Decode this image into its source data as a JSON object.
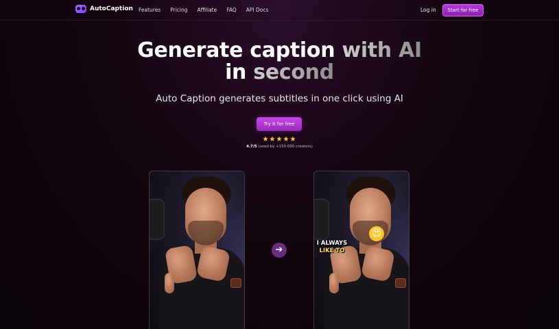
{
  "nav": {
    "brand": "AutoCaption",
    "links": [
      "Features",
      "Pricing",
      "Affiliate",
      "FAQ",
      "API Docs"
    ],
    "login": "Log in",
    "start": "Start for free"
  },
  "hero": {
    "title_line1_plain": "Generate caption ",
    "title_line1_grad": "with AI",
    "title_line2_plain": "in ",
    "title_line2_grad": "second",
    "subtitle": "Auto Caption generates subtitles in one click using AI",
    "cta": "Try it for free",
    "stars": "★★★★★",
    "rating_value": "4.7/5",
    "rating_text": " (used by +150.000 creators)"
  },
  "demo": {
    "caption_line1": "I ALWAYS",
    "caption_line2": "LIKE TO",
    "emoji": "😍",
    "arrow": "➔",
    "icons": [
      "logo-icon",
      "arrow-right-icon",
      "heart-eyes-emoji-icon"
    ]
  },
  "colors": {
    "accent": "#a832cf",
    "star": "#ffc542",
    "caption_highlight": "#ffe14d"
  }
}
